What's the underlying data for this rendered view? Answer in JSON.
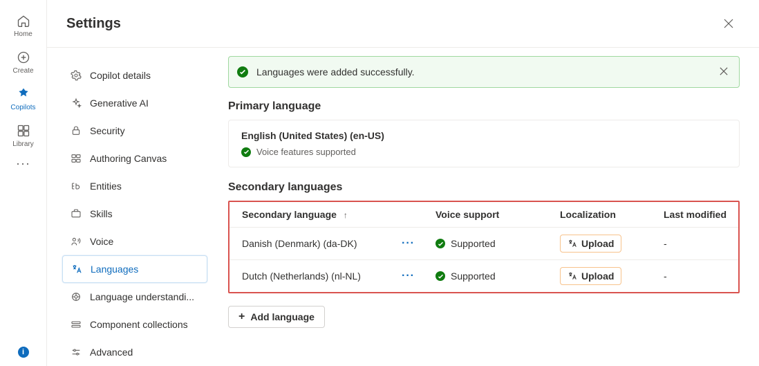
{
  "rail": {
    "home": "Home",
    "create": "Create",
    "copilots": "Copilots",
    "library": "Library"
  },
  "header": {
    "title": "Settings"
  },
  "sidebar": {
    "items": [
      {
        "label": "Copilot details"
      },
      {
        "label": "Generative AI"
      },
      {
        "label": "Security"
      },
      {
        "label": "Authoring Canvas"
      },
      {
        "label": "Entities"
      },
      {
        "label": "Skills"
      },
      {
        "label": "Voice"
      },
      {
        "label": "Languages"
      },
      {
        "label": "Language understandi..."
      },
      {
        "label": "Component collections"
      },
      {
        "label": "Advanced"
      }
    ],
    "activeIndex": 7
  },
  "banner": {
    "text": "Languages were added successfully."
  },
  "primary": {
    "section_title": "Primary language",
    "name": "English (United States) (en-US)",
    "voice_supported": "Voice features supported"
  },
  "secondary": {
    "section_title": "Secondary languages",
    "columns": {
      "name": "Secondary language",
      "voice": "Voice support",
      "localization": "Localization",
      "modified": "Last modified"
    },
    "rows": [
      {
        "name": "Danish (Denmark) (da-DK)",
        "voice": "Supported",
        "upload_label": "Upload",
        "modified": "-"
      },
      {
        "name": "Dutch (Netherlands) (nl-NL)",
        "voice": "Supported",
        "upload_label": "Upload",
        "modified": "-"
      }
    ],
    "add_label": "Add language"
  }
}
